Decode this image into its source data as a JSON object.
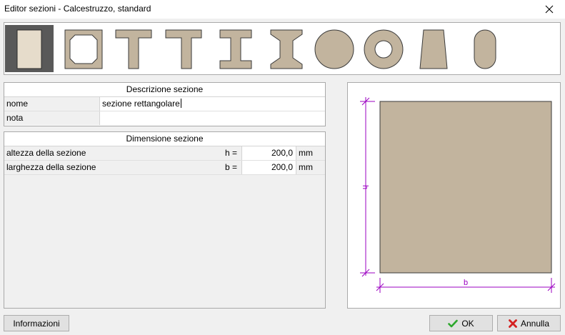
{
  "window": {
    "title": "Editor sezioni - Calcestruzzo, standard"
  },
  "shapes": [
    {
      "id": "rectangle",
      "selected": true
    },
    {
      "id": "hollow-octagon",
      "selected": false
    },
    {
      "id": "t-section",
      "selected": false
    },
    {
      "id": "l-section",
      "selected": false
    },
    {
      "id": "i-section",
      "selected": false
    },
    {
      "id": "i-section-tapered",
      "selected": false
    },
    {
      "id": "circle",
      "selected": false
    },
    {
      "id": "ring",
      "selected": false
    },
    {
      "id": "trapezoid",
      "selected": false
    },
    {
      "id": "oval",
      "selected": false
    }
  ],
  "description": {
    "header": "Descrizione sezione",
    "name_label": "nome",
    "name_value": "sezione rettangolare",
    "note_label": "nota",
    "note_value": ""
  },
  "dimensions": {
    "header": "Dimensione sezione",
    "rows": [
      {
        "label": "altezza della sezione",
        "symbol": "h =",
        "value": "200,0",
        "unit": "mm"
      },
      {
        "label": "larghezza della sezione",
        "symbol": "b =",
        "value": "200,0",
        "unit": "mm"
      }
    ]
  },
  "preview": {
    "height_label": "h",
    "width_label": "b",
    "fill_color": "#c2b49e",
    "dim_color": "#9b00c2"
  },
  "buttons": {
    "info": "Informazioni",
    "ok": "OK",
    "cancel": "Annulla"
  }
}
